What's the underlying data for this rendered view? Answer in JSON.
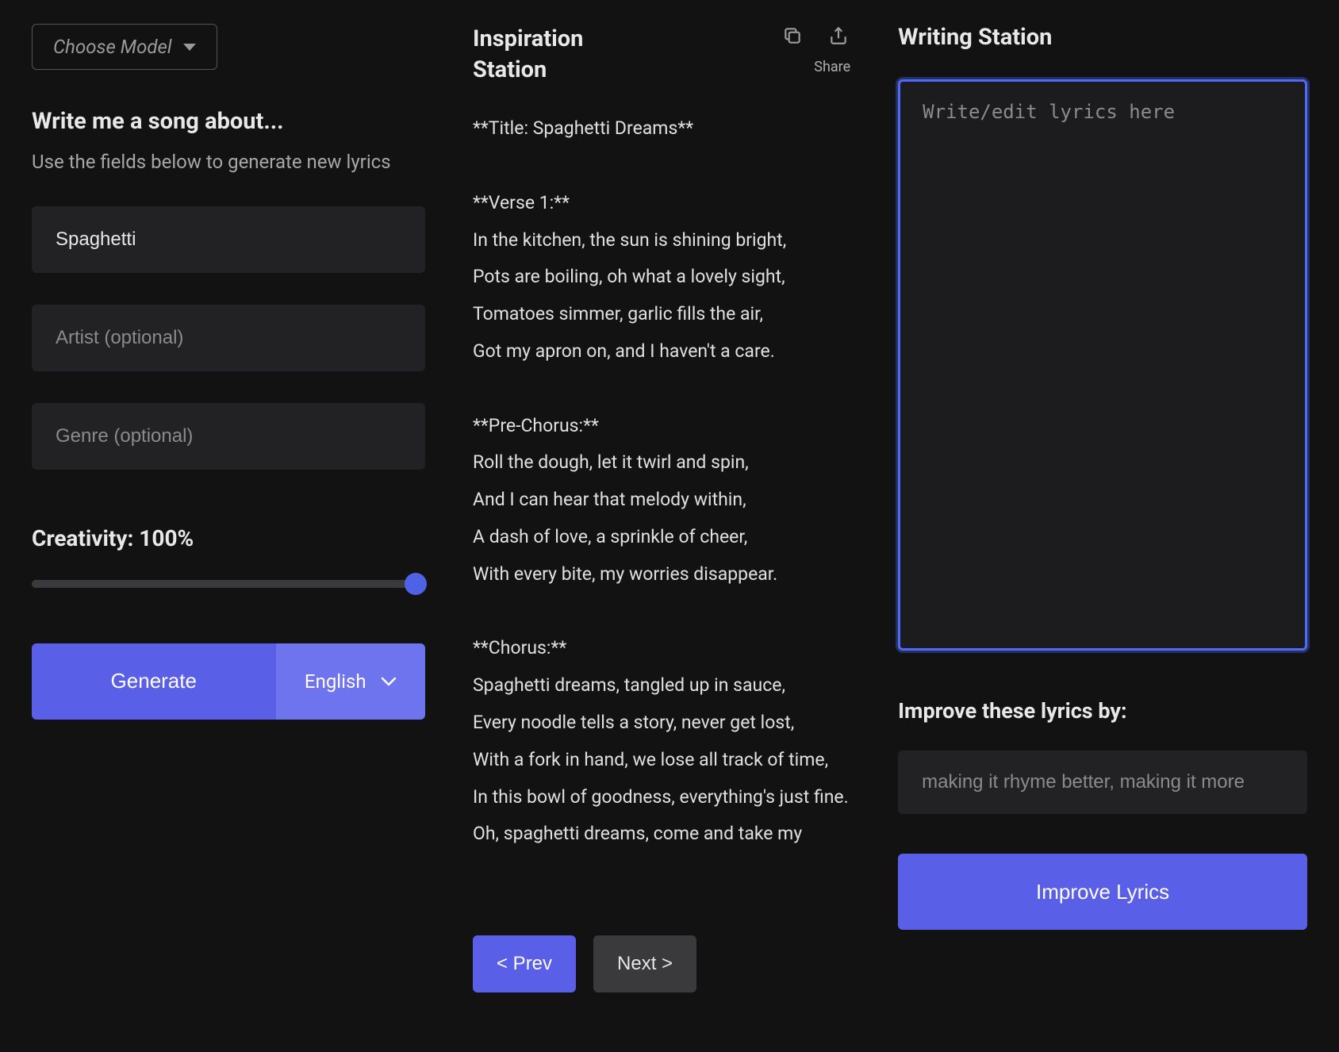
{
  "left": {
    "model_placeholder": "Choose Model",
    "prompt_title": "Write me a song about...",
    "prompt_sub": "Use the fields below to generate new lyrics",
    "topic_value": "Spaghetti",
    "artist_placeholder": "Artist (optional)",
    "genre_placeholder": "Genre (optional)",
    "creativity_label": "Creativity: 100%",
    "creativity_value": 100,
    "generate_label": "Generate",
    "language_selected": "English"
  },
  "middle": {
    "title": "Inspiration\nStation",
    "share_label": "Share",
    "lyrics_lines": [
      "**Title: Spaghetti Dreams**",
      "",
      "**Verse 1:**",
      "In the kitchen, the sun is shining bright,",
      "Pots are boiling, oh what a lovely sight,",
      "Tomatoes simmer, garlic fills the air,",
      "Got my apron on, and I haven't a care.",
      "",
      "**Pre-Chorus:**",
      "Roll the dough, let it twirl and spin,",
      "And I can hear that melody within,",
      "A dash of love, a sprinkle of cheer,",
      "With every bite, my worries disappear.",
      "",
      "**Chorus:**",
      "Spaghetti dreams, tangled up in sauce,",
      "Every noodle tells a story, never get lost,",
      "With a fork in hand, we lose all track of time,",
      "In this bowl of goodness, everything's just fine.",
      "Oh, spaghetti dreams, come and take my"
    ],
    "prev_label": "< Prev",
    "next_label": "Next >"
  },
  "right": {
    "title": "Writing Station",
    "editor_placeholder": "Write/edit lyrics here",
    "editor_value": "",
    "improve_title": "Improve these lyrics by:",
    "improve_placeholder": "making it rhyme better, making it more",
    "improve_button": "Improve Lyrics"
  },
  "colors": {
    "accent": "#5a5fe8",
    "accent_light": "#6e73ee",
    "focus_ring": "#4f6af8"
  }
}
